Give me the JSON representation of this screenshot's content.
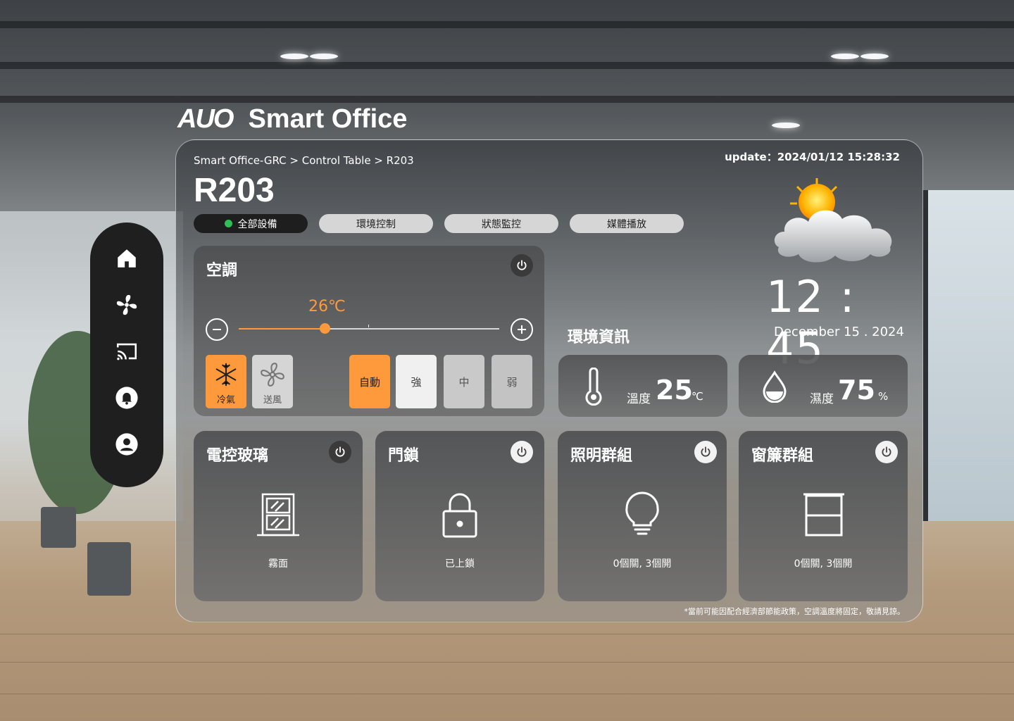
{
  "brand": {
    "logo": "AUO",
    "title": "Smart Office"
  },
  "sidebar": {
    "items": [
      {
        "icon": "home-icon"
      },
      {
        "icon": "fan-icon"
      },
      {
        "icon": "cast-icon"
      },
      {
        "icon": "bell-icon"
      },
      {
        "icon": "user-icon"
      }
    ]
  },
  "header": {
    "breadcrumb": "Smart Office-GRC > Control Table > R203",
    "update": "update：2024/01/12 15:28:32",
    "room": "R203"
  },
  "tabs": [
    {
      "label": "全部設備",
      "active": true
    },
    {
      "label": "環境控制",
      "active": false
    },
    {
      "label": "狀態監控",
      "active": false
    },
    {
      "label": "媒體播放",
      "active": false
    }
  ],
  "ac": {
    "title": "空調",
    "temperature": "26℃",
    "slider_fraction": 0.33,
    "modes": {
      "cool": "冷氣",
      "fan": "送風"
    },
    "speeds": {
      "auto": "自動",
      "strong": "強",
      "mid": "中",
      "weak": "弱"
    }
  },
  "env": {
    "title": "環境資訊",
    "temp_label": "溫度",
    "temp_value": "25",
    "temp_unit": "℃",
    "hum_label": "濕度",
    "hum_value": "75",
    "hum_unit": "%"
  },
  "clock": {
    "time": "12 : 45",
    "date": "December 15 . 2024"
  },
  "devices": {
    "glass": {
      "title": "電控玻璃",
      "status": "霧面"
    },
    "lock": {
      "title": "門鎖",
      "status": "已上鎖"
    },
    "light": {
      "title": "照明群組",
      "status": "0個關, 3個開"
    },
    "curtain": {
      "title": "窗簾群組",
      "status": "0個關, 3個開"
    }
  },
  "footnote": "*當前可能因配合經濟部節能政策，空調溫度將固定，敬請見諒。",
  "colors": {
    "accent": "#ff9a3c",
    "active_dot": "#2fbf57",
    "tab_active": "#1e1e1e"
  }
}
